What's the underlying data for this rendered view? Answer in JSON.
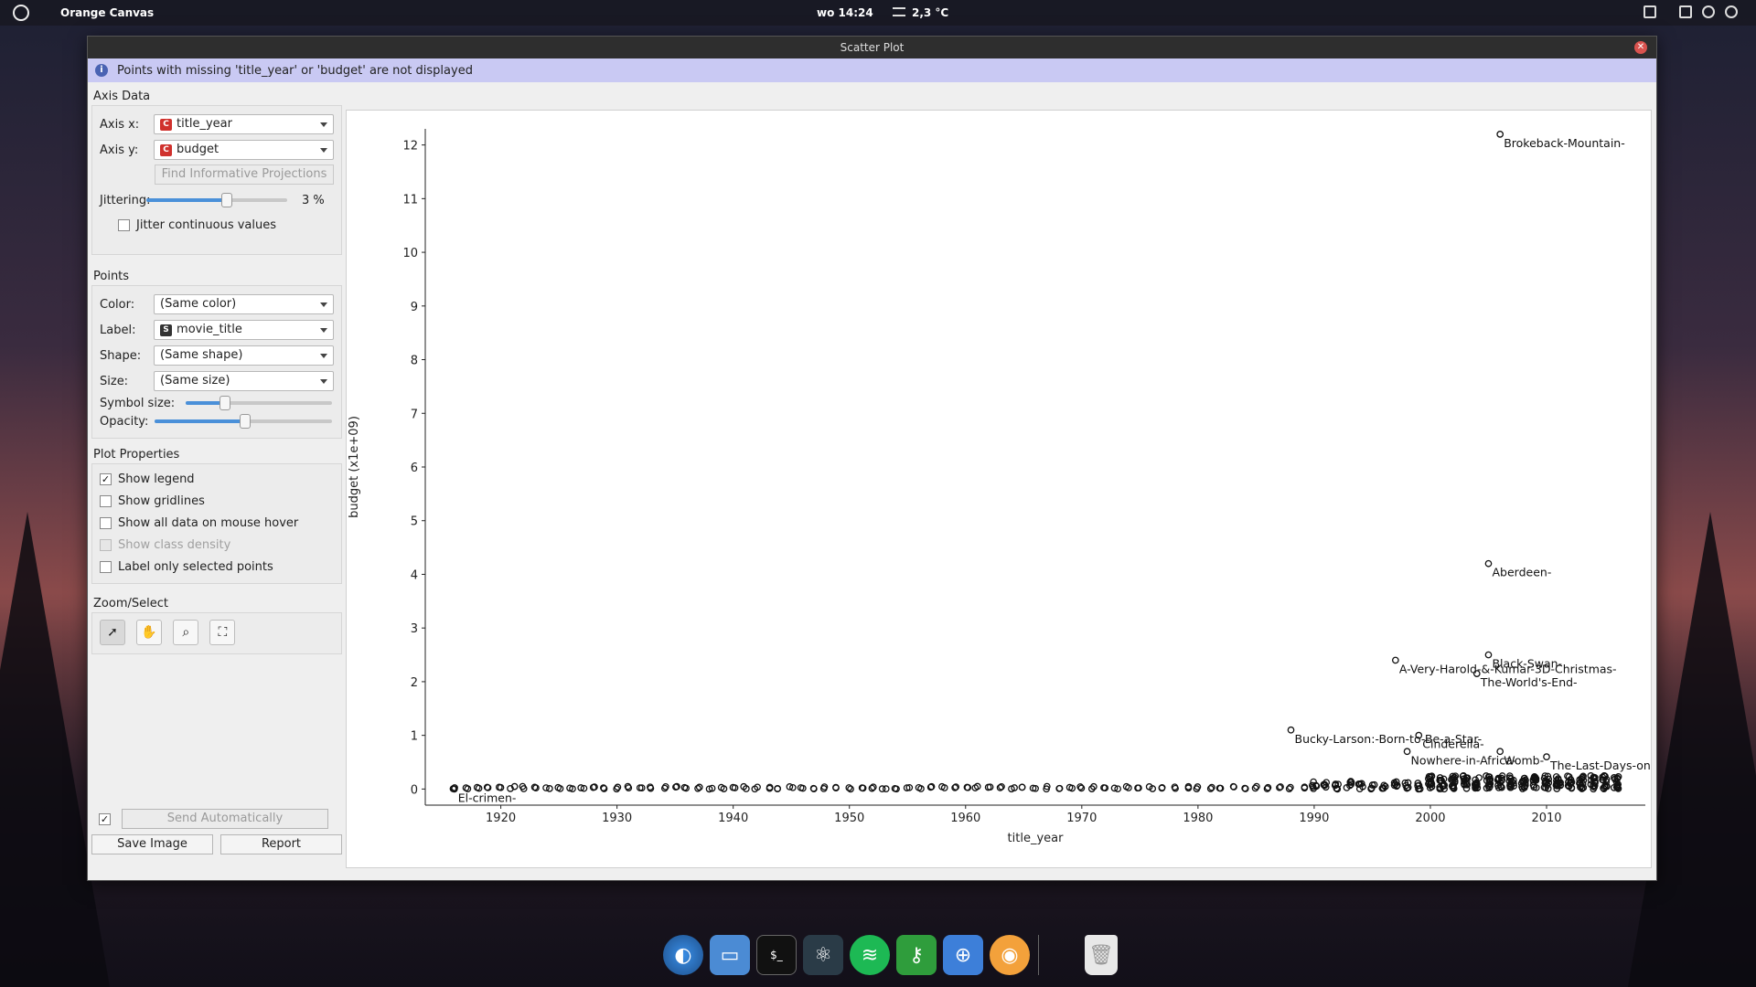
{
  "topbar": {
    "app_name": "Orange Canvas",
    "clock": "wo 14:24",
    "weather": "2,3 °C"
  },
  "window": {
    "title": "Scatter Plot",
    "info_message": "Points with missing 'title_year' or 'budget' are not displayed"
  },
  "axis_data": {
    "section_title": "Axis Data",
    "axis_x_label": "Axis x:",
    "axis_x_value": "title_year",
    "axis_y_label": "Axis y:",
    "axis_y_value": "budget",
    "find_projections_label": "Find Informative Projections",
    "jittering_label": "Jittering:",
    "jittering_value": "3 %",
    "jitter_continuous_label": "Jitter continuous values"
  },
  "points": {
    "section_title": "Points",
    "color_label": "Color:",
    "color_value": "(Same color)",
    "label_label": "Label:",
    "label_value": "movie_title",
    "shape_label": "Shape:",
    "shape_value": "(Same shape)",
    "size_label": "Size:",
    "size_value": "(Same size)",
    "symbol_size_label": "Symbol size:",
    "opacity_label": "Opacity:"
  },
  "plot_properties": {
    "section_title": "Plot Properties",
    "show_legend": "Show legend",
    "show_gridlines": "Show gridlines",
    "show_all_data": "Show all data on mouse hover",
    "show_class_density": "Show class density",
    "label_only_selected": "Label only selected points"
  },
  "zoom_select": {
    "section_title": "Zoom/Select"
  },
  "bottom": {
    "send_auto_label": "Send Automatically",
    "save_image_label": "Save Image",
    "report_label": "Report"
  },
  "chart_data": {
    "type": "scatter",
    "xlabel": "title_year",
    "ylabel": "budget (x1e+09)",
    "xlim": [
      1913.5,
      2018.5
    ],
    "ylim": [
      -0.3,
      12.3
    ],
    "xticks": [
      1920,
      1930,
      1940,
      1950,
      1960,
      1970,
      1980,
      1990,
      2000,
      2010
    ],
    "yticks": [
      0,
      1,
      2,
      3,
      4,
      5,
      6,
      7,
      8,
      9,
      10,
      11,
      12
    ],
    "grid": false,
    "labeled_points": [
      {
        "x": 2006,
        "y": 12.2,
        "label": "Brokeback-Mountain-"
      },
      {
        "x": 2005,
        "y": 4.2,
        "label": "Aberdeen-"
      },
      {
        "x": 2005,
        "y": 2.5,
        "label": "Black-Swan-"
      },
      {
        "x": 1997,
        "y": 2.4,
        "label": "A-Very-Harold-&-Kumar-3D-Christmas-"
      },
      {
        "x": 2004,
        "y": 2.15,
        "label": "The-World's-End-"
      },
      {
        "x": 1988,
        "y": 1.1,
        "label": "Bucky-Larson:-Born-to-Be-a-Star-"
      },
      {
        "x": 1999,
        "y": 1.0,
        "label": "Cinderella-"
      },
      {
        "x": 1998,
        "y": 0.7,
        "label": "Nowhere-in-Africa-"
      },
      {
        "x": 2006,
        "y": 0.7,
        "label": "Womb-"
      },
      {
        "x": 2010,
        "y": 0.6,
        "label": "The-Last-Days-on"
      },
      {
        "x": 1916,
        "y": 0.0,
        "label": "El-crimen-"
      }
    ]
  }
}
